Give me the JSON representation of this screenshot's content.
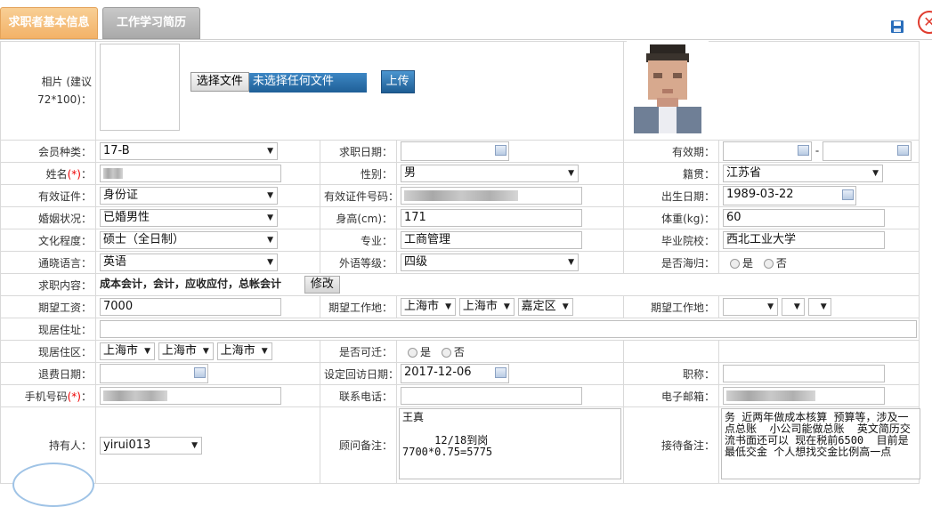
{
  "tabs": [
    "求职者基本信息",
    "工作学习简历"
  ],
  "toolbar": {
    "save_icon": "save-icon",
    "close_icon": "close-icon",
    "close_glyph": "✕"
  },
  "photo": {
    "label": "相片 (建议72*100)：",
    "choose_button": "选择文件",
    "file_status": "未选择任何文件",
    "upload_button": "上传"
  },
  "labels": {
    "member_type": "会员种类：",
    "job_date": "求职日期：",
    "valid_period": "有效期：",
    "name": "姓名",
    "gender": "性别：",
    "native_place": "籍贯：",
    "id_type": "有效证件：",
    "id_number": "有效证件号码：",
    "birth_date": "出生日期：",
    "marital": "婚姻状况：",
    "height": "身高(cm)：",
    "weight": "体重(kg)：",
    "education": "文化程度：",
    "major": "专业：",
    "school": "毕业院校：",
    "language": "通晓语言：",
    "foreign_level": "外语等级：",
    "returnee": "是否海归：",
    "job_content": "求职内容：",
    "expected_salary": "期望工资：",
    "expected_location": "期望工作地：",
    "expected_location2": "期望工作地：",
    "current_address": "现居住址：",
    "current_area": "现居住区：",
    "relocate": "是否可迁：",
    "refund_date": "退费日期：",
    "revisit_date": "设定回访日期：",
    "title": "职称：",
    "mobile": "手机号码",
    "contact_phone": "联系电话：",
    "email": "电子邮箱：",
    "owner": "持有人：",
    "consultant_note": "顾问备注：",
    "reception_note": "接待备注：",
    "required_mark": "(*)",
    "colon": "："
  },
  "values": {
    "member_type": "17-B",
    "valid_period_sep": "-",
    "gender": "男",
    "native_place": "江苏省",
    "id_type": "身份证",
    "birth_date": "1989-03-22",
    "marital": "已婚男性",
    "height": "171",
    "weight": "60",
    "education": "硕士（全日制）",
    "major": "工商管理",
    "school": "西北工业大学",
    "language": "英语",
    "foreign_level": "四级",
    "returnee_yes": "是",
    "returnee_no": "否",
    "job_content": "成本会计，会计，应收应付，总帐会计",
    "modify_button": "修改",
    "expected_salary": "7000",
    "exp_city1": "上海市",
    "exp_city2": "上海市",
    "exp_district": "嘉定区",
    "cur_city1": "上海市",
    "cur_city2": "上海市",
    "cur_city3": "上海市",
    "relocate_yes": "是",
    "relocate_no": "否",
    "revisit_date": "2017-12-06",
    "owner": "yirui013",
    "consultant_note": "王真\n\n     12/18到岗\n7700*0.75=5775",
    "reception_note": "务 近两年做成本核算 预算等，涉及一点总账  小公司能做总账  英文简历交流书面还可以 现在税前6500  目前是最低交金 个人想找交金比例高一点"
  }
}
